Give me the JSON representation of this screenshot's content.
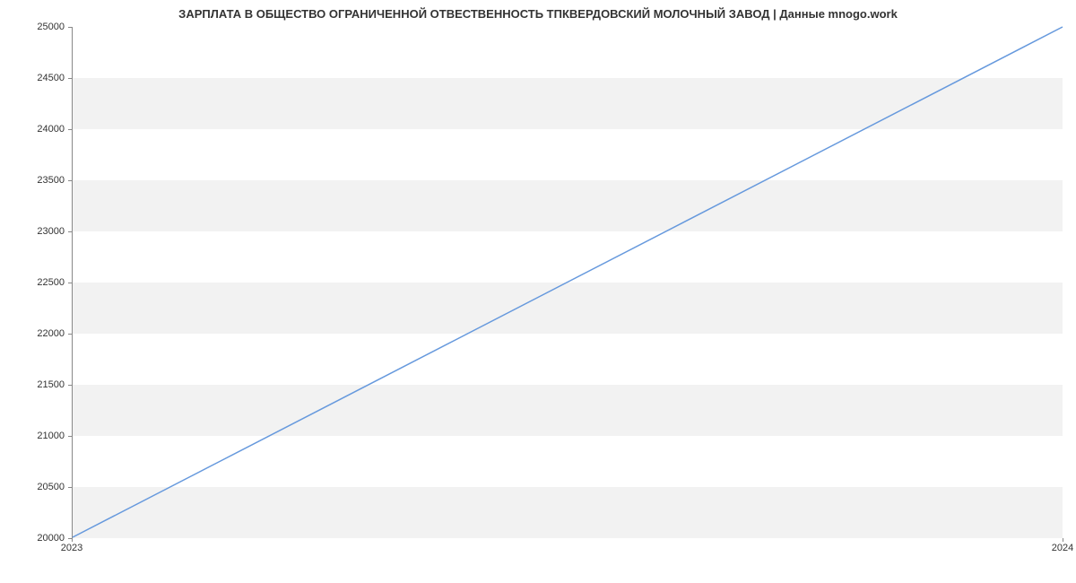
{
  "chart_data": {
    "type": "line",
    "title": "ЗАРПЛАТА В ОБЩЕСТВО ОГРАНИЧЕННОЙ ОТВЕСТВЕННОСТЬ ТПКВЕРДОВСКИЙ МОЛОЧНЫЙ ЗАВОД | Данные mnogo.work",
    "x": [
      2023,
      2024
    ],
    "values": [
      20000,
      25000
    ],
    "xlabel": "",
    "ylabel": "",
    "xlim": [
      2023,
      2024
    ],
    "ylim": [
      20000,
      25000
    ],
    "y_ticks": [
      20000,
      20500,
      21000,
      21500,
      22000,
      22500,
      23000,
      23500,
      24000,
      24500,
      25000
    ],
    "x_ticks": [
      2023,
      2024
    ],
    "line_color": "#6699dd"
  }
}
